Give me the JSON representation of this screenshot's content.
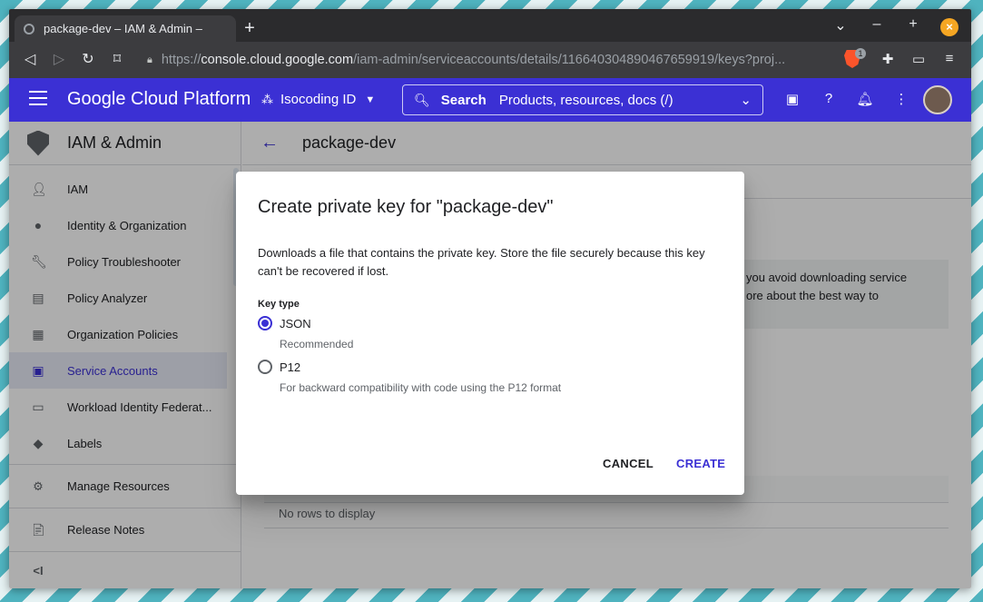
{
  "browser": {
    "tab_title": "package-dev – IAM & Admin – ",
    "url_prefix": "https://",
    "url_host": "console.cloud.google.com",
    "url_path": "/iam-admin/serviceaccounts/details/116640304890467659919/keys?proj...",
    "brave_badge": "1"
  },
  "header": {
    "title": "Google Cloud Platform",
    "project": "Isocoding ID",
    "search_label": "Search",
    "search_placeholder": "Products, resources, docs (/)"
  },
  "sidebar": {
    "title": "IAM & Admin",
    "items": [
      {
        "label": "IAM",
        "icon": "person-add-icon"
      },
      {
        "label": "Identity & Organization",
        "icon": "account-circle-icon"
      },
      {
        "label": "Policy Troubleshooter",
        "icon": "wrench-icon"
      },
      {
        "label": "Policy Analyzer",
        "icon": "document-search-icon"
      },
      {
        "label": "Organization Policies",
        "icon": "list-document-icon"
      },
      {
        "label": "Service Accounts",
        "icon": "service-account-icon",
        "active": true
      },
      {
        "label": "Workload Identity Federat...",
        "icon": "id-card-icon"
      },
      {
        "label": "Labels",
        "icon": "label-icon"
      }
    ],
    "manage_resources": "Manage Resources",
    "release_notes": "Release Notes",
    "collapse": "<I"
  },
  "main": {
    "title": "package-dev",
    "info_text_line1": "you avoid downloading service",
    "info_text_line2": "ore about the best way to",
    "no_rows": "No rows to display"
  },
  "dialog": {
    "title": "Create private key for \"package-dev\"",
    "description": "Downloads a file that contains the private key. Store the file securely because this key can't be recovered if lost.",
    "key_type_label": "Key type",
    "options": [
      {
        "label": "JSON",
        "sub": "Recommended",
        "checked": true
      },
      {
        "label": "P12",
        "sub": "For backward compatibility with code using the P12 format",
        "checked": false
      }
    ],
    "cancel_label": "CANCEL",
    "create_label": "CREATE"
  },
  "colors": {
    "brand": "#3b30d4",
    "scrim": "rgba(0,0,0,0.32)"
  }
}
